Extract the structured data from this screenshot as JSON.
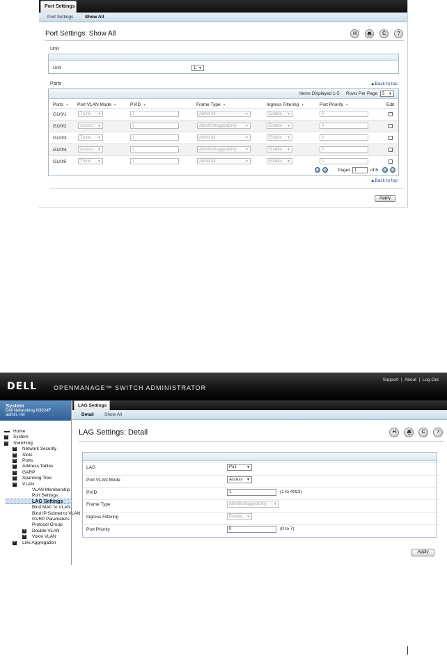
{
  "screen1": {
    "top_tab": "Port Settings",
    "subtabs": [
      "Port Settings",
      "Show All"
    ],
    "title": "Port Settings: Show All",
    "icons": [
      "save-icon",
      "print-icon",
      "refresh-icon",
      "help-icon"
    ],
    "icon_glyphs": {
      "save": "H",
      "refresh": "C",
      "help": "?"
    },
    "unit_section": "Unit",
    "unit_label": "Unit",
    "unit_value": "1",
    "ports_section": "Ports",
    "back_to_top": "Back to top",
    "items_displayed": "Items Displayed 1-5",
    "rows_per_page_label": "Rows Per Page",
    "rows_per_page_value": "5",
    "columns": [
      "Ports",
      "Port VLAN Mode",
      "PVID",
      "Frame Type",
      "Ingress Filtering",
      "Port Priority",
      "Edit"
    ],
    "rows": [
      {
        "port": "G1/0/1",
        "mode": "Trunk",
        "pvid": "1",
        "frame": "Admit All",
        "ingress": "Enable",
        "priority": "0",
        "alt": false
      },
      {
        "port": "G1/0/2",
        "mode": "Access",
        "pvid": "1",
        "frame": "AdmitUntaggedOnly",
        "ingress": "Enable",
        "priority": "0",
        "alt": true
      },
      {
        "port": "G1/0/3",
        "mode": "Trunk",
        "pvid": "1",
        "frame": "Admit All",
        "ingress": "Enable",
        "priority": "0",
        "alt": false
      },
      {
        "port": "G1/0/4",
        "mode": "Access",
        "pvid": "1",
        "frame": "AdmitUntaggedOnly",
        "ingress": "Enable",
        "priority": "0",
        "alt": true
      },
      {
        "port": "G1/0/5",
        "mode": "Trunk",
        "pvid": "1",
        "frame": "Admit All",
        "ingress": "Enable",
        "priority": "0",
        "alt": false
      }
    ],
    "pages_label": "Pages",
    "page_value": "1",
    "page_total": "of 6",
    "apply": "Apply"
  },
  "screen2": {
    "brand": "DELL",
    "product": "OPENMANAGE™ SWITCH ADMINISTRATOR",
    "top_links": [
      "Support",
      "About",
      "Log Out"
    ],
    "system": {
      "title": "System",
      "model": "Dell Networking N3024F",
      "user": "admin, r/w"
    },
    "tree": [
      {
        "label": "Home",
        "level": 0,
        "marker": "line"
      },
      {
        "label": "System",
        "level": 0,
        "marker": "plus"
      },
      {
        "label": "Switching",
        "level": 0,
        "marker": "minus"
      },
      {
        "label": "Network Security",
        "level": 1,
        "marker": "plus"
      },
      {
        "label": "Slots",
        "level": 1,
        "marker": "plus"
      },
      {
        "label": "Ports",
        "level": 1,
        "marker": "plus"
      },
      {
        "label": "Address Tables",
        "level": 1,
        "marker": "plus"
      },
      {
        "label": "GARP",
        "level": 1,
        "marker": "plus"
      },
      {
        "label": "Spanning Tree",
        "level": 1,
        "marker": "plus"
      },
      {
        "label": "VLAN",
        "level": 1,
        "marker": "minus"
      },
      {
        "label": "VLAN Membership",
        "level": 2,
        "marker": "none"
      },
      {
        "label": "Port Settings",
        "level": 2,
        "marker": "none"
      },
      {
        "label": "LAG Settings",
        "level": 2,
        "marker": "none",
        "selected": true
      },
      {
        "label": "Bind MAC to VLAN",
        "level": 2,
        "marker": "none"
      },
      {
        "label": "Bind IP Subnet to VLAN",
        "level": 2,
        "marker": "none"
      },
      {
        "label": "GVRP Parameters",
        "level": 2,
        "marker": "none"
      },
      {
        "label": "Protocol Group",
        "level": 2,
        "marker": "none"
      },
      {
        "label": "Double VLAN",
        "level": 2,
        "marker": "plus"
      },
      {
        "label": "Voice VLAN",
        "level": 2,
        "marker": "plus"
      },
      {
        "label": "Link Aggregation",
        "level": 1,
        "marker": "plus"
      }
    ],
    "top_tab": "LAG Settings",
    "subtabs": [
      "Detail",
      "Show All"
    ],
    "title": "LAG Settings: Detail",
    "fields": [
      {
        "label": "LAG",
        "type": "select",
        "value": "Po1",
        "hint": ""
      },
      {
        "label": "Port VLAN Mode",
        "type": "select",
        "value": "Access",
        "hint": ""
      },
      {
        "label": "PVID",
        "type": "text",
        "value": "1",
        "hint": "(1 to 4093)"
      },
      {
        "label": "Frame Type",
        "type": "select-disabled",
        "value": "AdmitUntaggedOnly",
        "hint": ""
      },
      {
        "label": "Ingress Filtering",
        "type": "select-disabled",
        "value": "Enable",
        "hint": ""
      },
      {
        "label": "Port Priority",
        "type": "text",
        "value": "0",
        "hint": "(0 to 7)"
      }
    ],
    "apply": "Apply"
  }
}
